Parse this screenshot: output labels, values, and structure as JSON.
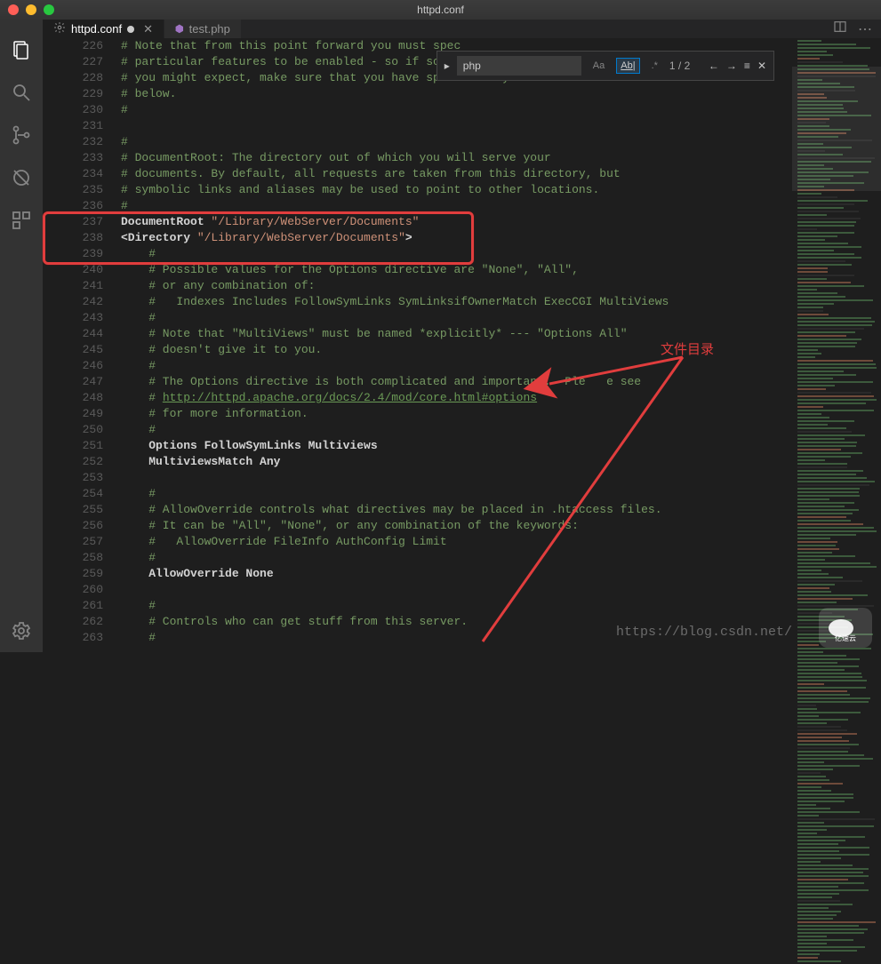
{
  "window": {
    "title": "httpd.conf"
  },
  "activitybar": {
    "items": [
      "explorer",
      "search",
      "git",
      "debug",
      "extensions"
    ],
    "bottom": [
      "settings"
    ]
  },
  "tabs": [
    {
      "label": "httpd.conf",
      "icon": "gear-icon",
      "active": true,
      "closable": true
    },
    {
      "label": "test.php",
      "icon": "php-icon",
      "active": false,
      "closable": false
    }
  ],
  "find": {
    "value": "php",
    "count": "1 / 2",
    "options": {
      "case": false,
      "word": true,
      "regex": false
    }
  },
  "annotation": "文件目录",
  "watermark": "https://blog.csdn.net/",
  "gutter_start": 226,
  "lines": [
    {
      "n": 226,
      "t": "# Note that from this point forward you must spec",
      "cls": "cmt"
    },
    {
      "n": 227,
      "t": "# particular features to be enabled - so if somet",
      "cls": "cmt"
    },
    {
      "n": 228,
      "t": "# you might expect, make sure that you have specifically enabled it",
      "cls": "cmt"
    },
    {
      "n": 229,
      "t": "# below.",
      "cls": "cmt"
    },
    {
      "n": 230,
      "t": "#",
      "cls": "cmt"
    },
    {
      "n": 231,
      "t": "",
      "cls": ""
    },
    {
      "n": 232,
      "t": "#",
      "cls": "cmt"
    },
    {
      "n": 233,
      "t": "# DocumentRoot: The directory out of which you will serve your",
      "cls": "cmt"
    },
    {
      "n": 234,
      "t": "# documents. By default, all requests are taken from this directory, but",
      "cls": "cmt"
    },
    {
      "n": 235,
      "t": "# symbolic links and aliases may be used to point to other locations.",
      "cls": "cmt"
    },
    {
      "n": 236,
      "t": "#",
      "cls": "cmt"
    },
    {
      "n": 237,
      "t": "",
      "cls": "mixed",
      "segments": [
        {
          "t": "DocumentRoot ",
          "c": "kw"
        },
        {
          "t": "\"/Library/WebServer/Documents\"",
          "c": "str"
        }
      ]
    },
    {
      "n": 238,
      "t": "",
      "cls": "mixed",
      "segments": [
        {
          "t": "<Directory ",
          "c": "tagkw"
        },
        {
          "t": "\"/Library/WebServer/Documents\"",
          "c": "str"
        },
        {
          "t": ">",
          "c": "tagkw"
        }
      ]
    },
    {
      "n": 239,
      "t": "    #",
      "cls": "cmt"
    },
    {
      "n": 240,
      "t": "    # Possible values for the Options directive are \"None\", \"All\",",
      "cls": "cmt"
    },
    {
      "n": 241,
      "t": "    # or any combination of:",
      "cls": "cmt"
    },
    {
      "n": 242,
      "t": "    #   Indexes Includes FollowSymLinks SymLinksifOwnerMatch ExecCGI MultiViews",
      "cls": "cmt"
    },
    {
      "n": 243,
      "t": "    #",
      "cls": "cmt"
    },
    {
      "n": 244,
      "t": "    # Note that \"MultiViews\" must be named *explicitly* --- \"Options All\"",
      "cls": "cmt"
    },
    {
      "n": 245,
      "t": "    # doesn't give it to you.",
      "cls": "cmt"
    },
    {
      "n": 246,
      "t": "    #",
      "cls": "cmt"
    },
    {
      "n": 247,
      "t": "    # The Options directive is both complicated and important.  Ple   e see",
      "cls": "cmt"
    },
    {
      "n": 248,
      "t": "",
      "cls": "mixed",
      "segments": [
        {
          "t": "    # ",
          "c": "cmt"
        },
        {
          "t": "http://httpd.apache.org/docs/2.4/mod/core.html#options",
          "c": "link"
        }
      ]
    },
    {
      "n": 249,
      "t": "    # for more information.",
      "cls": "cmt"
    },
    {
      "n": 250,
      "t": "    #",
      "cls": "cmt"
    },
    {
      "n": 251,
      "t": "    Options FollowSymLinks Multiviews",
      "cls": "kw"
    },
    {
      "n": 252,
      "t": "    MultiviewsMatch Any",
      "cls": "kw"
    },
    {
      "n": 253,
      "t": "",
      "cls": ""
    },
    {
      "n": 254,
      "t": "    #",
      "cls": "cmt"
    },
    {
      "n": 255,
      "t": "    # AllowOverride controls what directives may be placed in .htaccess files.",
      "cls": "cmt"
    },
    {
      "n": 256,
      "t": "    # It can be \"All\", \"None\", or any combination of the keywords:",
      "cls": "cmt"
    },
    {
      "n": 257,
      "t": "    #   AllowOverride FileInfo AuthConfig Limit",
      "cls": "cmt"
    },
    {
      "n": 258,
      "t": "    #",
      "cls": "cmt"
    },
    {
      "n": 259,
      "t": "    AllowOverride None",
      "cls": "kw"
    },
    {
      "n": 260,
      "t": "",
      "cls": ""
    },
    {
      "n": 261,
      "t": "    #",
      "cls": "cmt"
    },
    {
      "n": 262,
      "t": "    # Controls who can get stuff from this server.",
      "cls": "cmt"
    },
    {
      "n": 263,
      "t": "    #",
      "cls": "cmt"
    }
  ],
  "logo": "亿速云"
}
